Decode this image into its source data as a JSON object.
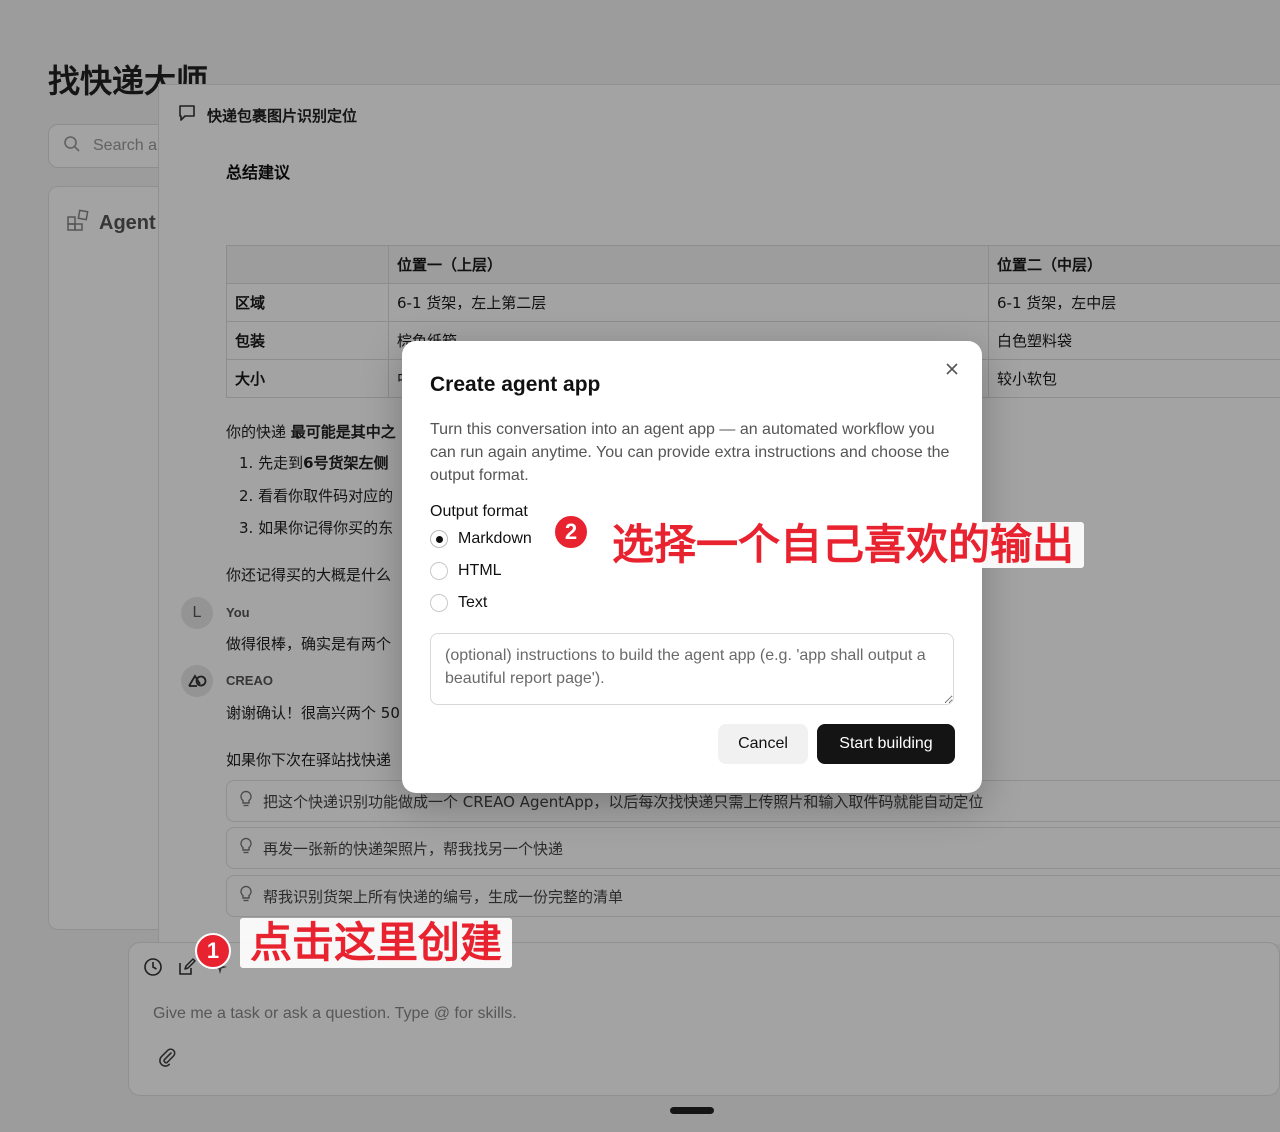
{
  "background": {
    "app_title": "找快递大师",
    "search_placeholder": "Search a",
    "agent_label": "Agent"
  },
  "conversation": {
    "title": "快递包裹图片识别定位",
    "summary_heading": "总结建议",
    "table": {
      "headers": [
        "",
        "位置一（上层）",
        "位置二（中层）"
      ],
      "rows": [
        [
          "区域",
          "6-1 货架，左上第二层",
          "6-1 货架，左中层"
        ],
        [
          "包装",
          "棕色纸箱",
          "白色塑料袋"
        ],
        [
          "大小",
          "中",
          "较小软包"
        ]
      ]
    },
    "para_intro_prefix": "你的快递",
    "para_intro_bold": "最可能是其中之",
    "list_items": [
      {
        "num": "1.",
        "prefix": "先走到",
        "bold": "6号货架左侧"
      },
      {
        "num": "2.",
        "prefix": "看看你取件码对应的",
        "bold": ""
      },
      {
        "num": "3.",
        "prefix": "如果你记得你买的东",
        "bold": ""
      }
    ],
    "question": "你还记得买的大概是什么",
    "user_avatar": "L",
    "user_name": "You",
    "user_msg": "做得很棒，确实是有两个",
    "bot_name": "CREAO",
    "bot_msg": "谢谢确认！很高兴两个 50",
    "next_time": "如果你下次在驿站找快递",
    "suggestions": [
      "把这个快递识别功能做成一个 CREAO AgentApp，以后每次找快递只需上传照片和输入取件码就能自动定位",
      "再发一张新的快递架照片，帮我找另一个快递",
      "帮我识别货架上所有快递的编号，生成一份完整的清单"
    ]
  },
  "composer": {
    "placeholder": "Give me a task or ask a question. Type @ for skills."
  },
  "modal": {
    "title": "Create agent app",
    "description": "Turn this conversation into an agent app — an automated workflow you can run again anytime. You can provide extra instructions and choose the output format.",
    "output_format_label": "Output format",
    "options": [
      "Markdown",
      "HTML",
      "Text"
    ],
    "selected_option": "Markdown",
    "instructions_placeholder": "(optional) instructions to build the agent app (e.g. 'app shall output a beautiful report page').",
    "cancel_label": "Cancel",
    "start_label": "Start building"
  },
  "annotations": {
    "step1_number": "1",
    "step1_text": "点击这里创建",
    "step2_number": "2",
    "step2_text": "选择一个自己喜欢的输出",
    "accent_color": "#e8232f"
  }
}
